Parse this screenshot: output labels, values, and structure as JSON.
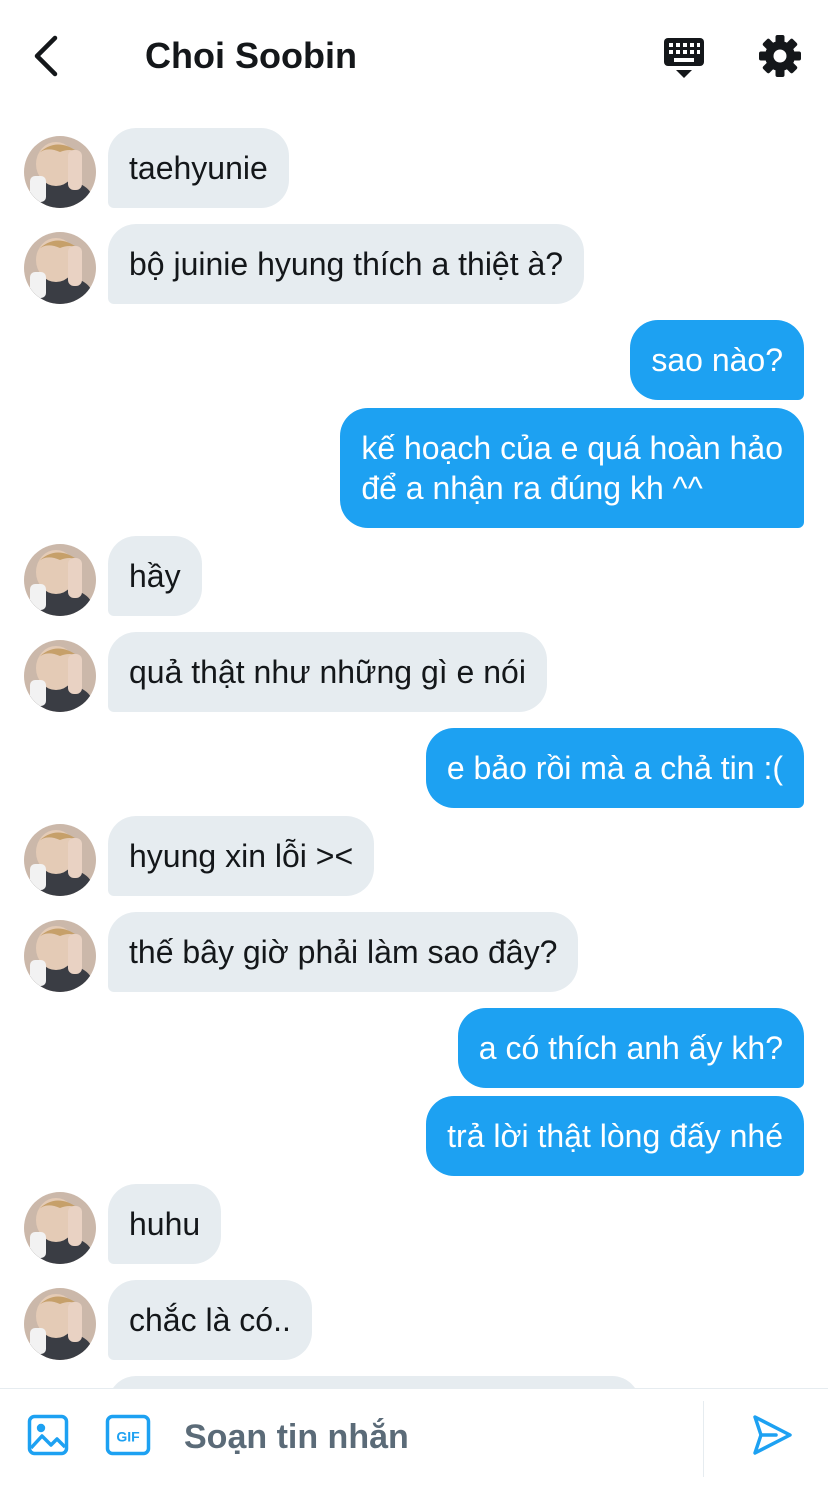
{
  "header": {
    "title": "Choi Soobin",
    "icons": {
      "back": "chevron-left-icon",
      "keyboard": "keyboard-icon",
      "settings": "gear-icon"
    }
  },
  "messages": [
    {
      "side": "in",
      "text": "taehyunie"
    },
    {
      "side": "in",
      "text": "bộ juinie hyung thích a thiệt à?"
    },
    {
      "side": "out",
      "text": "sao nào?"
    },
    {
      "side": "out",
      "text": "kế hoạch của e quá hoàn hảo\nđể a nhận ra đúng kh ^^"
    },
    {
      "side": "in",
      "text": "hầy"
    },
    {
      "side": "in",
      "text": "quả thật như những gì e nói"
    },
    {
      "side": "out",
      "text": "e bảo rồi mà a chả tin :("
    },
    {
      "side": "in",
      "text": "hyung xin lỗi ><"
    },
    {
      "side": "in",
      "text": "thế bây giờ phải làm sao đây?"
    },
    {
      "side": "out",
      "text": "a có thích anh ấy kh?"
    },
    {
      "side": "out",
      "text": "trả lời thật lòng đấy nhé"
    },
    {
      "side": "in",
      "text": "huhu"
    },
    {
      "side": "in",
      "text": "chắc là có.."
    },
    {
      "side": "in",
      "text": ""
    }
  ],
  "composer": {
    "placeholder": "Soạn tin nhắn",
    "gif_label": "GIF",
    "icons": {
      "image": "image-icon",
      "gif": "gif-icon",
      "send": "send-icon"
    }
  },
  "colors": {
    "accent": "#1da1f2",
    "incoming_bubble": "#e6ecf0",
    "text": "#14171a",
    "muted": "#657786"
  }
}
